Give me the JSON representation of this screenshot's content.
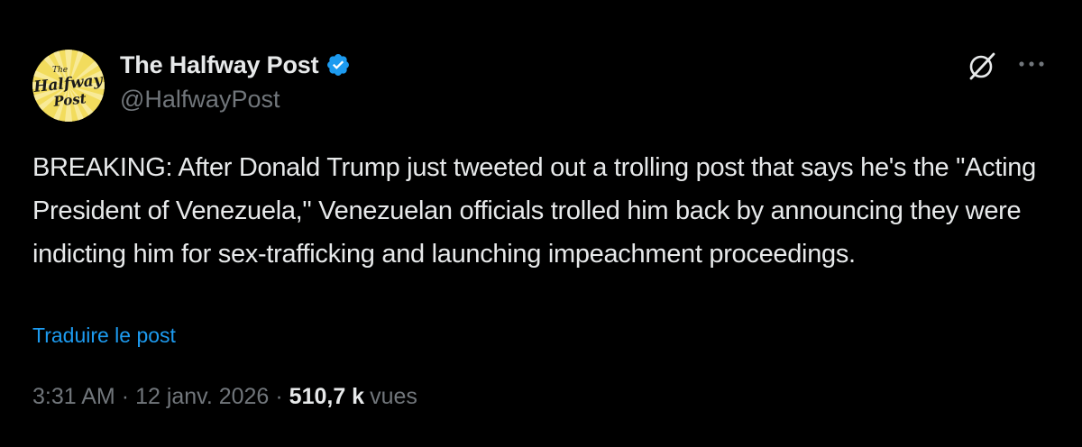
{
  "author": {
    "name": "The Halfway Post",
    "handle": "@HalfwayPost",
    "verified": true,
    "avatar_text": {
      "line1": "The",
      "line2": "Halfway",
      "line3": "Post"
    },
    "avatar_colors": {
      "background": "#f2dc5d",
      "rays": "#f8ea98",
      "text": "#1a1a1a"
    }
  },
  "icons": {
    "verified": "verified-badge-icon",
    "grok": "grok-icon",
    "more": "more-icon"
  },
  "tweet": {
    "text": "BREAKING: After Donald Trump just tweeted out a trolling post that says he's the \"Acting President of Venezuela,\" Venezuelan officials trolled him back by announcing they were indicting him for sex-trafficking and launching impeachment proceedings.",
    "translate_label": "Traduire le post"
  },
  "meta": {
    "time": "3:31 AM",
    "separator": "·",
    "date": "12 janv. 2026",
    "views_count": "510,7 k",
    "views_label": "vues"
  },
  "colors": {
    "background": "#000000",
    "primary_text": "#e7e9ea",
    "secondary_text": "#71767b",
    "link": "#1d9bf0",
    "verified": "#1d9bf0"
  }
}
